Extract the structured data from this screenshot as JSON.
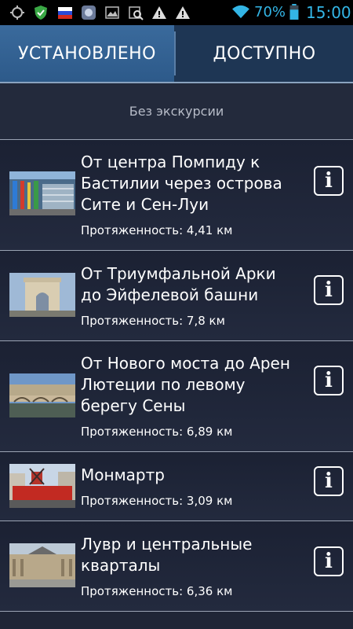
{
  "status_bar": {
    "icons": [
      "gps-icon",
      "shield-icon",
      "russia-flag-icon",
      "app-icon",
      "image-icon",
      "search-image-icon",
      "warning-icon",
      "warning-icon",
      "wifi-icon",
      "battery-icon"
    ],
    "battery": "70%",
    "time": "15:00"
  },
  "tabs": {
    "installed": "УСТАНОВЛЕНО",
    "available": "ДОСТУПНО"
  },
  "no_tour": "Без экскурсии",
  "tours": [
    {
      "title": "От центра Помпиду к Бастилии через острова Сите и Сен-Луи",
      "length": "Протяженность: 4,41 км",
      "thumb": "pompidou"
    },
    {
      "title": "От Триумфальной Арки до Эйфелевой башни",
      "length": "Протяженность: 7,8 км",
      "thumb": "arc"
    },
    {
      "title": "От Нового моста до Арен Лютеции по левому берегу Сены",
      "length": "Протяженность: 6,89 км",
      "thumb": "bridge"
    },
    {
      "title": "Монмартр",
      "length": "Протяженность: 3,09 км",
      "thumb": "moulin"
    },
    {
      "title": "Лувр и центральные кварталы",
      "length": "Протяженность: 6,36 км",
      "thumb": "louvre"
    }
  ],
  "info_label": "i",
  "colors": {
    "accent": "#33b5e5",
    "tab_active": "#2d5a8a",
    "background": "#1f2536"
  }
}
